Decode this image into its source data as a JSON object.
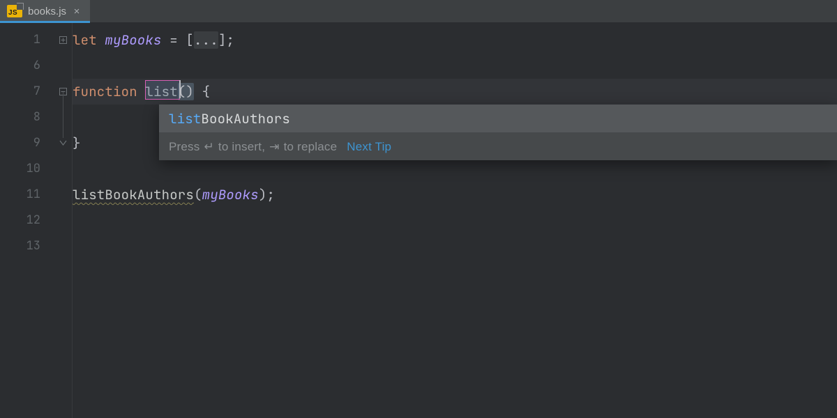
{
  "tab": {
    "filename": "books.js",
    "badge": "JS"
  },
  "gutter": {
    "lines": [
      "1",
      "6",
      "7",
      "8",
      "9",
      "10",
      "11",
      "12",
      "13"
    ]
  },
  "code": {
    "line1": {
      "kw": "let ",
      "var": "myBooks",
      "eq": " = ",
      "lb": "[",
      "fold": "...",
      "rb": "]",
      "semi": ";"
    },
    "line7": {
      "kw": "function ",
      "name": "list",
      "parens": "()",
      "brace": " {"
    },
    "line9": {
      "brace": "}"
    },
    "line11": {
      "call": "listBookAuthors",
      "lp": "(",
      "arg": "myBooks",
      "rp": ")",
      "semi": ";"
    }
  },
  "completion": {
    "typed": "list",
    "rest": "BookAuthors",
    "hint_pre": "Press ",
    "hint_enter": "↵",
    "hint_mid": " to insert, ",
    "hint_tab": "⇥",
    "hint_post": " to replace",
    "next": "Next Tip"
  }
}
